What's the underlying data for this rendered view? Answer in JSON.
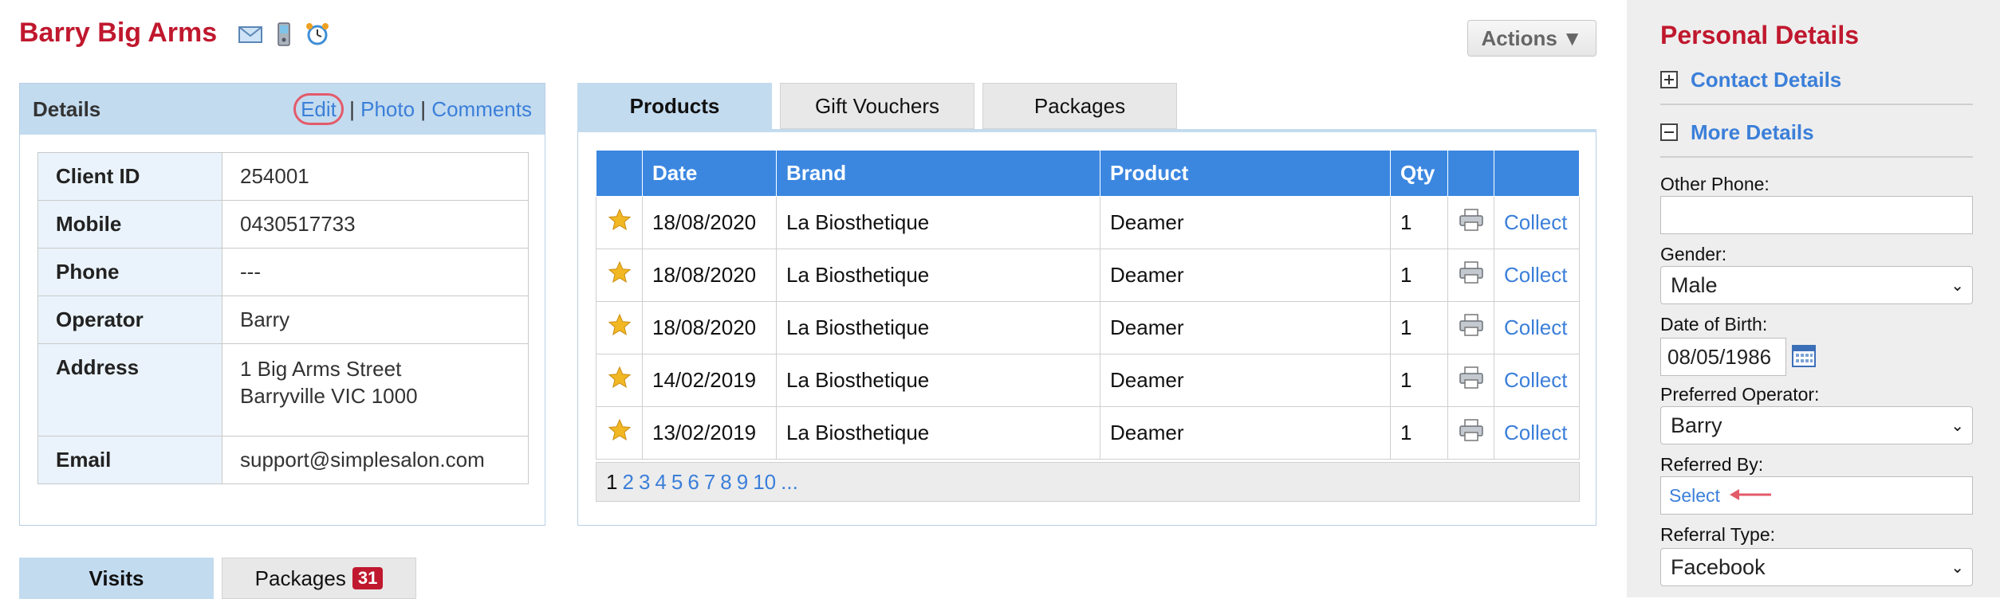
{
  "client": {
    "name": "Barry Big Arms",
    "icons": [
      "email-icon",
      "mobile-phone-icon",
      "alarm-clock-icon"
    ]
  },
  "actions": {
    "label": "Actions"
  },
  "details": {
    "title": "Details",
    "links": {
      "edit": "Edit",
      "photo": "Photo",
      "comments": "Comments",
      "separator": "|"
    },
    "rows": [
      {
        "label": "Client ID",
        "value": "254001"
      },
      {
        "label": "Mobile",
        "value": "0430517733"
      },
      {
        "label": "Phone",
        "value": "---"
      },
      {
        "label": "Operator",
        "value": "Barry"
      },
      {
        "label": "Address",
        "value_line1": "1 Big Arms Street",
        "value_line2": "Barryville VIC 1000"
      },
      {
        "label": "Email",
        "value": "support@simplesalon.com"
      }
    ]
  },
  "product_tabs": [
    {
      "label": "Products",
      "active": true
    },
    {
      "label": "Gift Vouchers",
      "active": false
    },
    {
      "label": "Packages",
      "active": false
    }
  ],
  "products": {
    "columns": [
      "",
      "Date",
      "Brand",
      "Product",
      "Qty",
      "",
      ""
    ],
    "rows": [
      {
        "date": "18/08/2020",
        "brand": "La Biosthetique",
        "product": "Deamer",
        "qty": "1",
        "action": "Collect"
      },
      {
        "date": "18/08/2020",
        "brand": "La Biosthetique",
        "product": "Deamer",
        "qty": "1",
        "action": "Collect"
      },
      {
        "date": "18/08/2020",
        "brand": "La Biosthetique",
        "product": "Deamer",
        "qty": "1",
        "action": "Collect"
      },
      {
        "date": "14/02/2019",
        "brand": "La Biosthetique",
        "product": "Deamer",
        "qty": "1",
        "action": "Collect"
      },
      {
        "date": "13/02/2019",
        "brand": "La Biosthetique",
        "product": "Deamer",
        "qty": "1",
        "action": "Collect"
      }
    ],
    "pager": {
      "current": "1",
      "pages": [
        "2",
        "3",
        "4",
        "5",
        "6",
        "7",
        "8",
        "9",
        "10",
        "..."
      ]
    }
  },
  "bottom_tabs": [
    {
      "label": "Visits",
      "active": true
    },
    {
      "label": "Packages",
      "badge": "31",
      "active": false
    }
  ],
  "right_panel": {
    "title": "Personal Details",
    "sections": [
      {
        "label": "Contact Details",
        "state": "collapsed"
      },
      {
        "label": "More Details",
        "state": "expanded"
      }
    ],
    "fields": {
      "other_phone": {
        "label": "Other Phone:",
        "value": ""
      },
      "gender": {
        "label": "Gender:",
        "value": "Male"
      },
      "dob": {
        "label": "Date of Birth:",
        "value": "08/05/1986"
      },
      "preferred_operator": {
        "label": "Preferred Operator:",
        "value": "Barry"
      },
      "referred_by": {
        "label": "Referred By:",
        "value": "Select"
      },
      "referral_type": {
        "label": "Referral Type:",
        "value": "Facebook"
      }
    }
  },
  "colors": {
    "brand_red": "#c0182e",
    "header_blue": "#3b87e0",
    "panel_blue": "#c3dbef",
    "link_blue": "#3b7fd9",
    "annotation_red": "#e35b6a",
    "star_gold": "#f2b824"
  }
}
